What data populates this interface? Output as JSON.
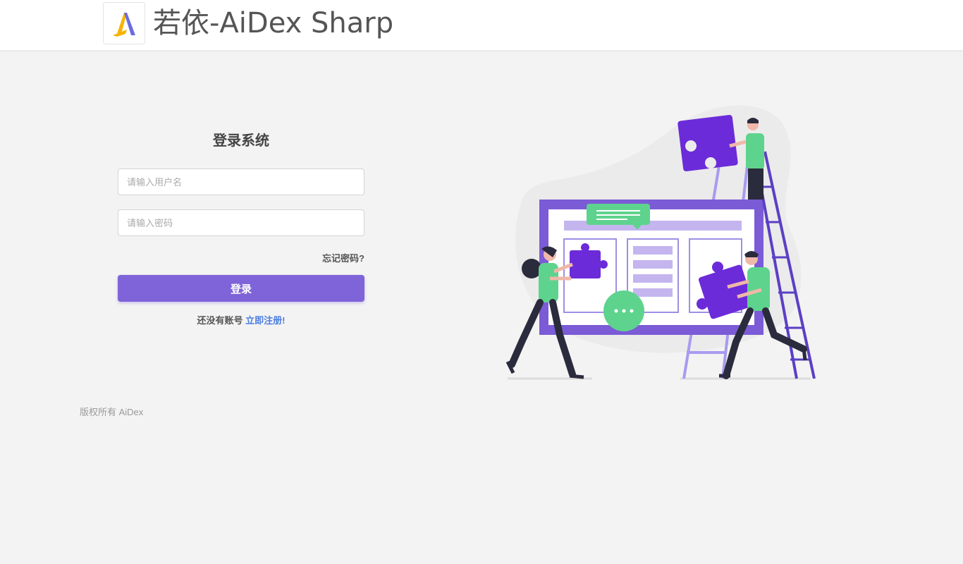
{
  "header": {
    "app_title": "若依-AiDex Sharp",
    "logo_icon": "aidex-logo-icon"
  },
  "login": {
    "title": "登录系统",
    "username_placeholder": "请输入用户名",
    "password_placeholder": "请输入密码",
    "forgot_label": "忘记密码?",
    "login_label": "登录",
    "no_account_text": "还没有账号",
    "register_label": "立即注册!"
  },
  "footer": {
    "copyright": "版权所有 AiDex"
  },
  "colors": {
    "accent": "#7f63d8",
    "link": "#4d7ee0",
    "illustration_purple": "#6c2bd9",
    "illustration_green": "#5ed38d"
  },
  "illustration": {
    "icon": "team-puzzle-illustration"
  }
}
